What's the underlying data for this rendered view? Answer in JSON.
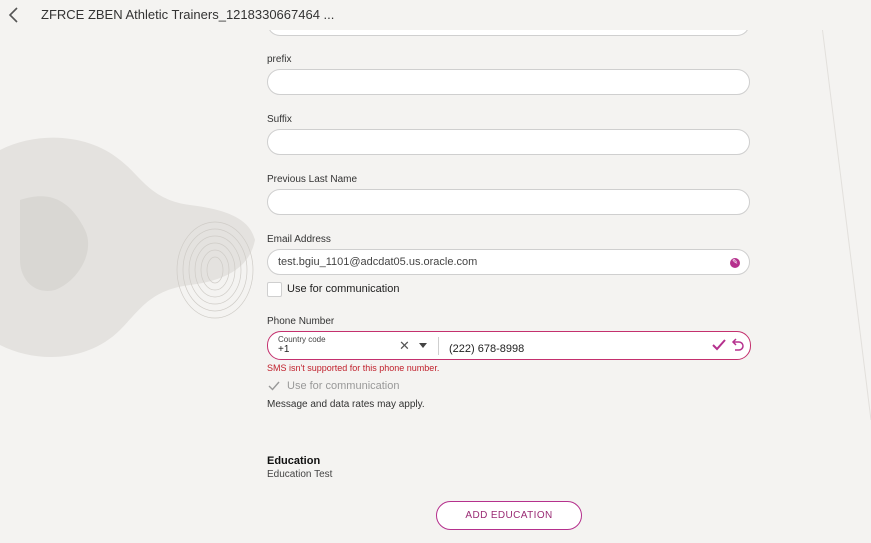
{
  "header": {
    "title": "ZFRCE ZBEN Athletic Trainers_1218330667464 ..."
  },
  "form": {
    "prefix_label": "prefix",
    "suffix_label": "Suffix",
    "previous_last_name_label": "Previous Last Name",
    "email": {
      "label": "Email Address",
      "value": "test.bgiu_1101@adcdat05.us.oracle.com",
      "use_for_communication": "Use for communication"
    },
    "phone": {
      "label": "Phone Number",
      "country_code_label": "Country code",
      "country_code_value": "+1",
      "number_value": "(222) 678-8998",
      "error": "SMS isn't supported for this phone number.",
      "use_for_communication": "Use for communication",
      "note": "Message and data rates may apply."
    }
  },
  "education": {
    "title": "Education",
    "item": "Education Test",
    "add_button": "ADD EDUCATION"
  },
  "colors": {
    "accent": "#b5308d",
    "error": "#c0202c",
    "background": "#f4f3f1"
  }
}
